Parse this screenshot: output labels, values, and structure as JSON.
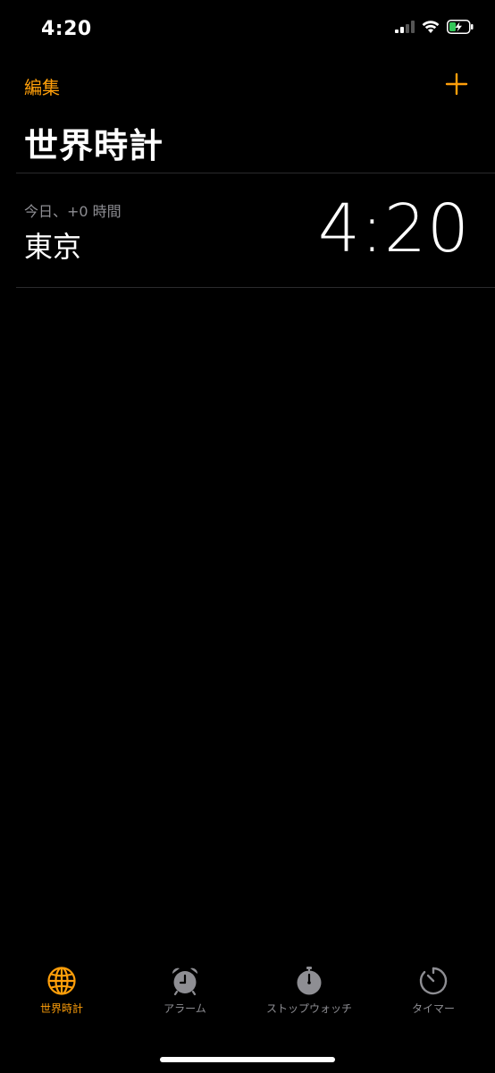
{
  "status_bar": {
    "time": "4:20",
    "signal_icon": "cellular-signal-icon",
    "wifi_icon": "wifi-icon",
    "battery_icon": "battery-charging-icon"
  },
  "nav": {
    "edit_label": "編集",
    "add_icon": "plus-icon"
  },
  "page_title": "世界時計",
  "clocks": [
    {
      "offset": "今日、+0 時間",
      "city": "東京",
      "time": "4:20"
    }
  ],
  "tab_bar": {
    "tabs": [
      {
        "label": "世界時計",
        "icon": "globe-icon",
        "active": true
      },
      {
        "label": "アラーム",
        "icon": "alarm-clock-icon",
        "active": false
      },
      {
        "label": "ストップウォッチ",
        "icon": "stopwatch-icon",
        "active": false
      },
      {
        "label": "タイマー",
        "icon": "timer-icon",
        "active": false
      }
    ]
  },
  "colors": {
    "accent": "#ff9f0a",
    "background": "#000000",
    "secondary_text": "#8e8e93",
    "separator": "#2a2a2c"
  }
}
